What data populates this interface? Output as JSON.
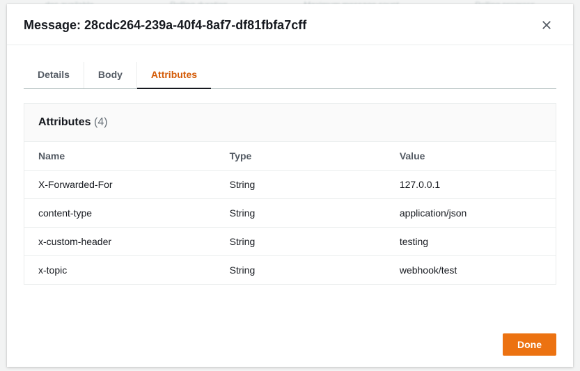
{
  "background": {
    "hints": [
      "des available",
      "Polling duration",
      "Maximum message count",
      "Polling progress"
    ]
  },
  "modal": {
    "title_prefix": "Message: ",
    "message_id": "28cdc264-239a-40f4-8af7-df81fbfa7cff",
    "tabs": [
      {
        "id": "details",
        "label": "Details",
        "active": false
      },
      {
        "id": "body",
        "label": "Body",
        "active": false
      },
      {
        "id": "attributes",
        "label": "Attributes",
        "active": true
      }
    ],
    "panel": {
      "title": "Attributes",
      "count_display": "(4)",
      "columns": {
        "name": "Name",
        "type": "Type",
        "value": "Value"
      },
      "rows": [
        {
          "name": "X-Forwarded-For",
          "type": "String",
          "value": "127.0.0.1"
        },
        {
          "name": "content-type",
          "type": "String",
          "value": "application/json"
        },
        {
          "name": "x-custom-header",
          "type": "String",
          "value": "testing"
        },
        {
          "name": "x-topic",
          "type": "String",
          "value": "webhook/test"
        }
      ]
    },
    "footer": {
      "done_label": "Done"
    }
  }
}
